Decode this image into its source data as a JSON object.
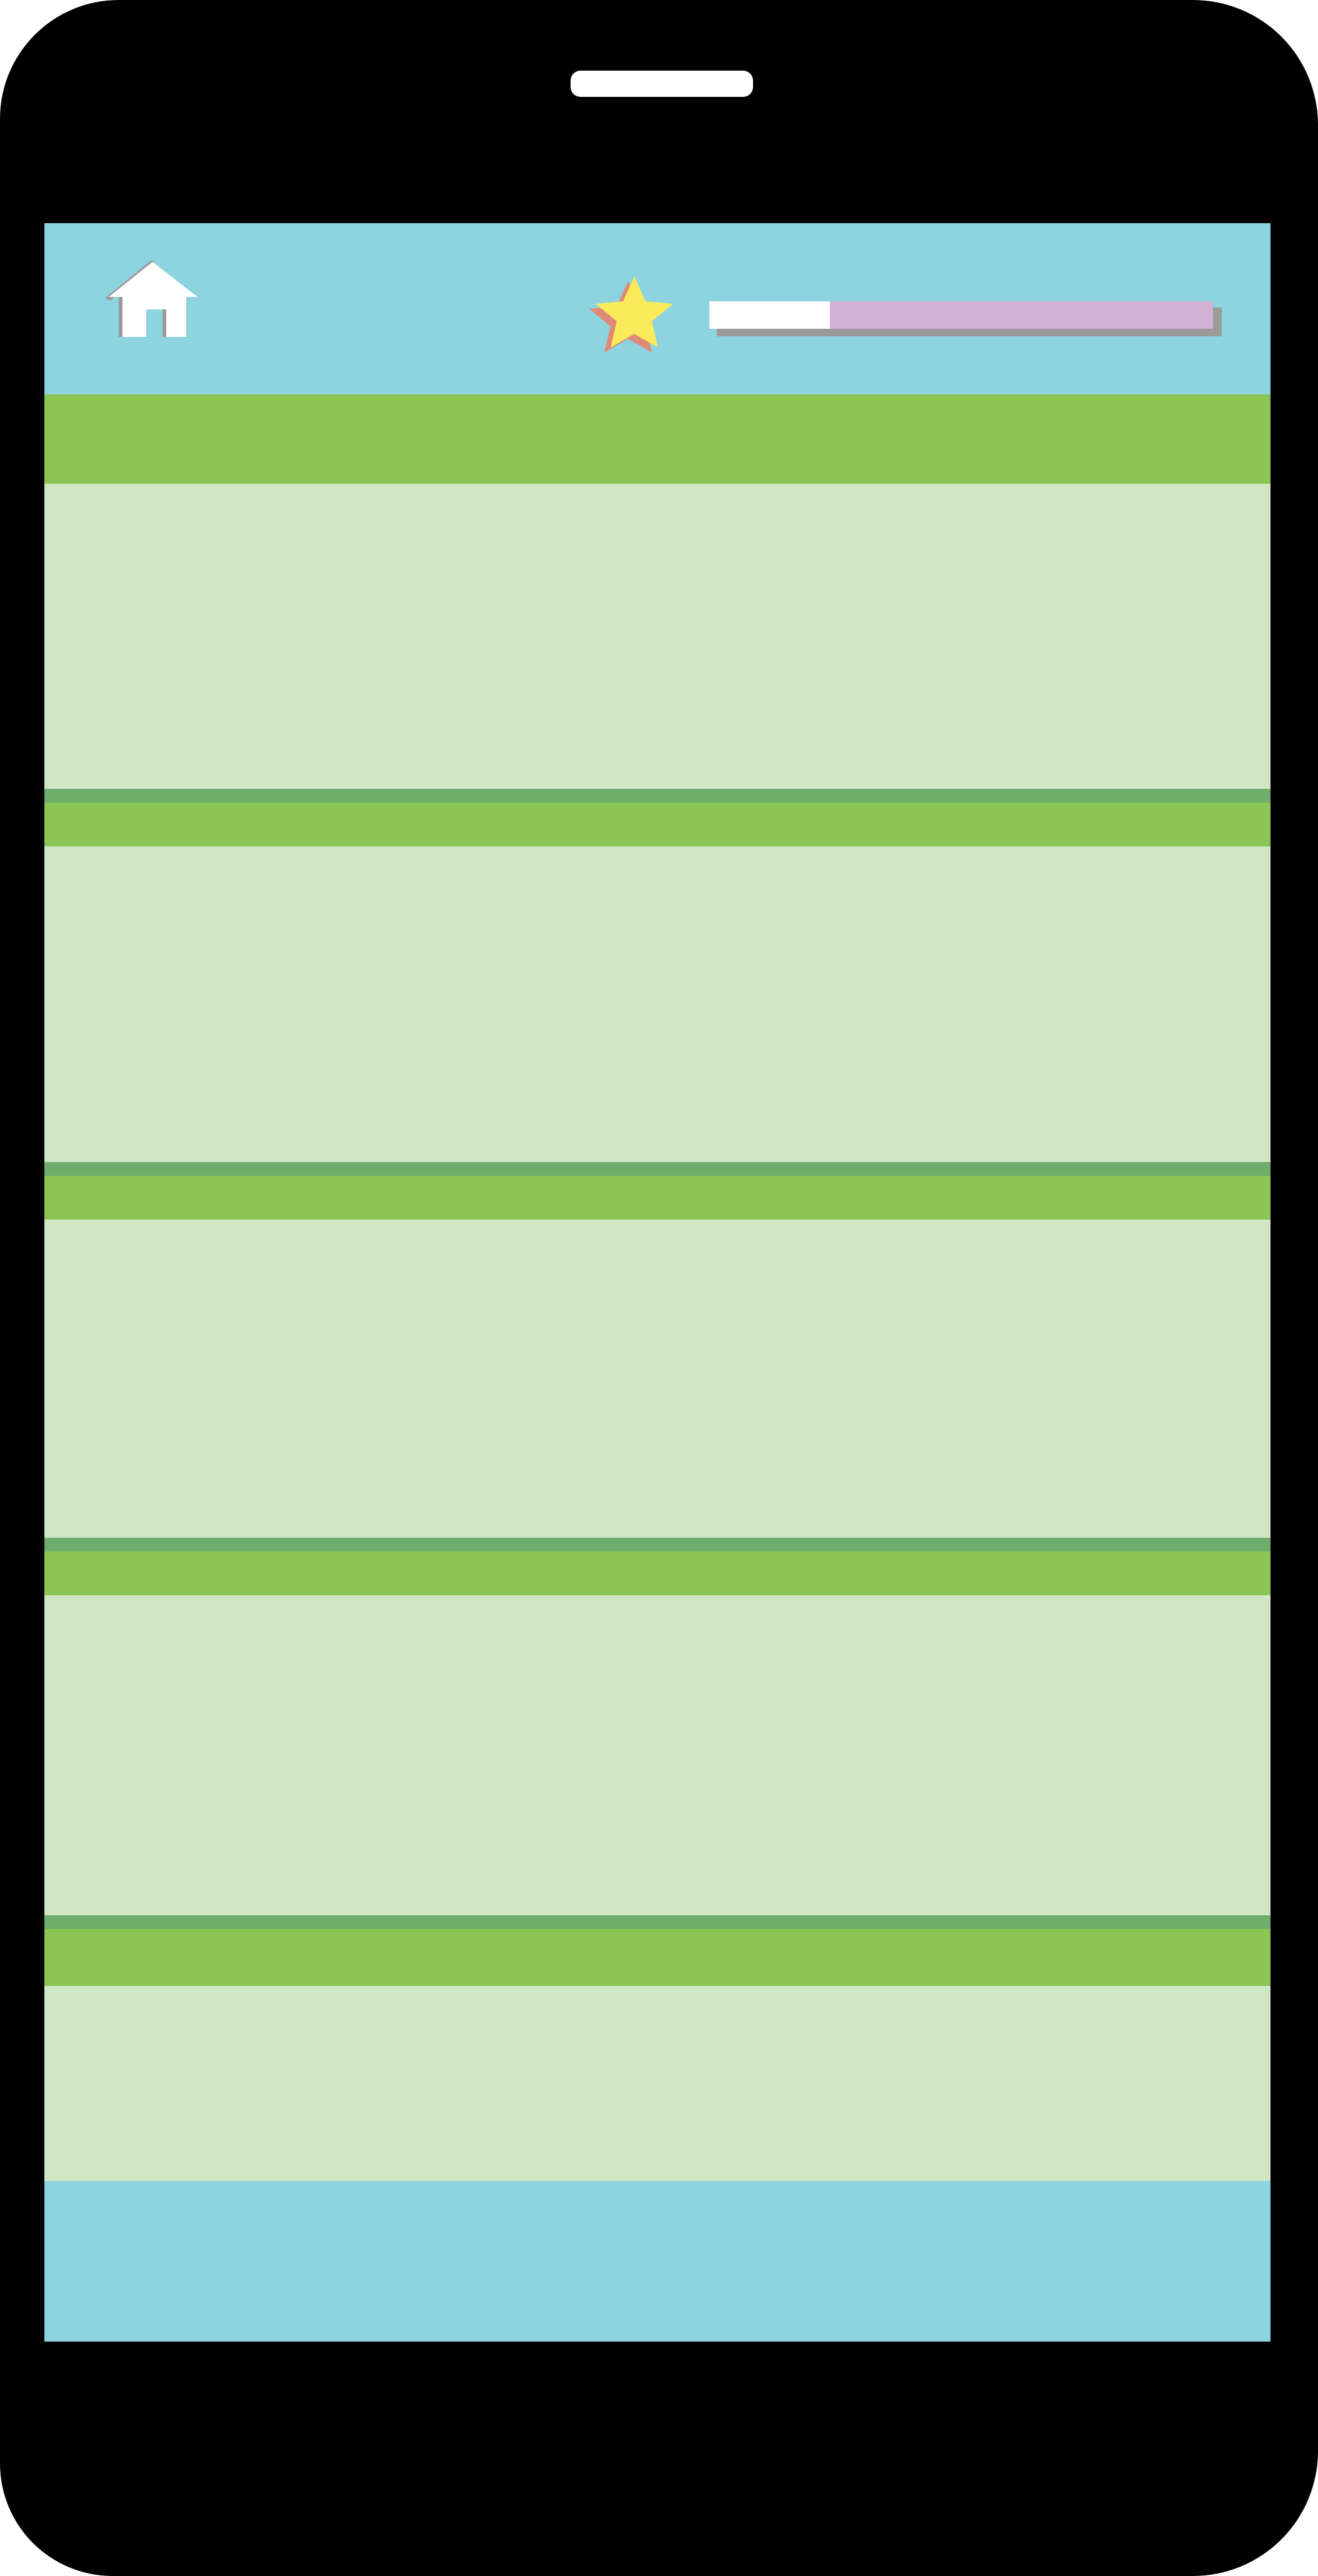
{
  "colors": {
    "device": "#000000",
    "top_bar": "#8dd3e0",
    "bottom_bar": "#8dd3e0",
    "row_header": "#8bc554",
    "row_body": "#d0e7c6",
    "row_divider": "#6fad6d",
    "progress_track": "#d3b0d6",
    "progress_fill": "#ffffff",
    "star": "#fbeb5b",
    "star_shadow": "#df8a76"
  },
  "icons": {
    "home": "home-icon",
    "star": "star-icon"
  },
  "progress": {
    "value": 0.24
  },
  "list": {
    "rows": [
      {
        "id": 1
      },
      {
        "id": 2
      },
      {
        "id": 3
      },
      {
        "id": 4
      },
      {
        "id": 5
      }
    ]
  }
}
